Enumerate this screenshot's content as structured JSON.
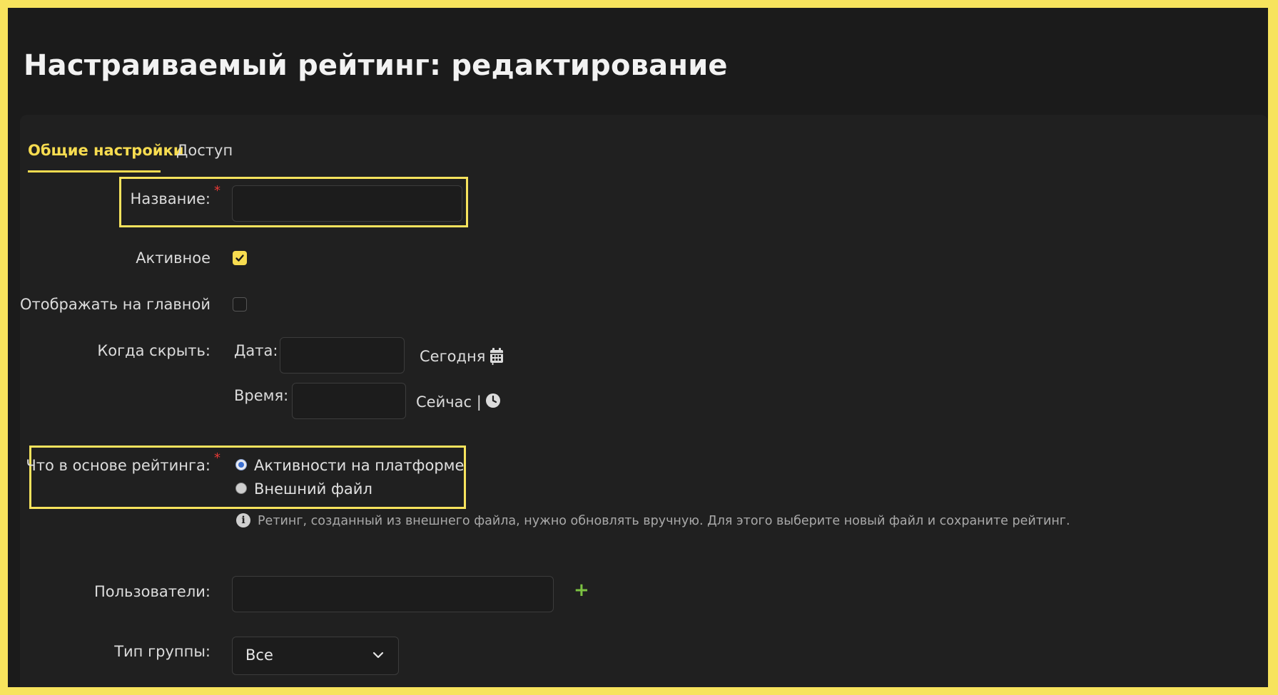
{
  "page": {
    "title": "Настраиваемый рейтинг: редактирование"
  },
  "tabs": [
    {
      "label": "Общие настройки",
      "active": true
    },
    {
      "label": "Доступ",
      "active": false
    }
  ],
  "form": {
    "name": {
      "label": "Название:",
      "required": "*",
      "value": ""
    },
    "active": {
      "label": "Активное",
      "checked": true
    },
    "show_on_main": {
      "label": "Отображать на главной",
      "checked": false
    },
    "hide_when": {
      "label": "Когда скрыть:",
      "date_label": "Дата:",
      "date_value": "",
      "today_link": "Сегодня |",
      "time_label": "Время:",
      "time_value": "",
      "now_link": "Сейчас |"
    },
    "rating_basis": {
      "label": "Что в основе рейтинга:",
      "required": "*",
      "options": [
        {
          "label": "Активности на платформе",
          "selected": true
        },
        {
          "label": "Внешний файл",
          "selected": false
        }
      ],
      "info_icon_text": "i",
      "info": "Ретинг, созданный из внешнего файла, нужно обновлять вручную. Для этого выберите новый файл и сохраните рейтинг."
    },
    "users": {
      "label": "Пользователи:",
      "value": "",
      "add_icon": "+"
    },
    "group_type": {
      "label": "Тип группы:",
      "selected": "Все"
    }
  },
  "colors": {
    "accent": "#f7dc50",
    "frame": "#f7e35d",
    "background": "#1b1b1b",
    "required": "#e53935",
    "add": "#7cc242"
  }
}
